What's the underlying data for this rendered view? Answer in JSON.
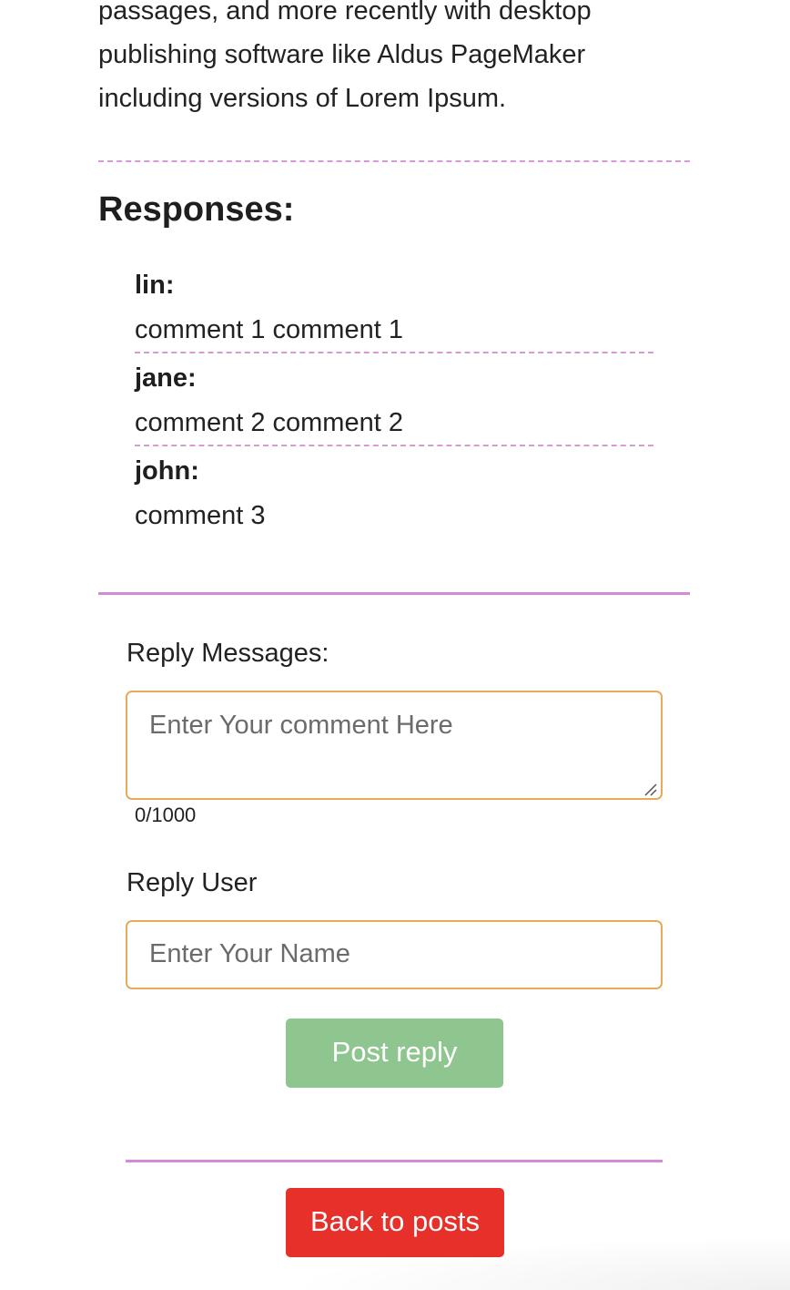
{
  "article": {
    "lines": [
      "passages, and more recently with desktop",
      "publishing software like Aldus PageMaker",
      "including versions of Lorem Ipsum."
    ]
  },
  "responses": {
    "heading": "Responses:",
    "items": [
      {
        "user": "lin:",
        "text": "comment 1 comment 1"
      },
      {
        "user": "jane:",
        "text": "comment 2 comment 2"
      },
      {
        "user": "john:",
        "text": "comment 3"
      }
    ]
  },
  "reply_form": {
    "message_label": "Reply Messages:",
    "message_placeholder": "Enter Your comment Here",
    "message_value": "",
    "char_counter": "0/1000",
    "user_label": "Reply User",
    "user_placeholder": "Enter Your Name",
    "user_value": "",
    "submit_label": "Post reply",
    "submit_color": "#8fc58f"
  },
  "navigation": {
    "back_label": "Back to posts",
    "back_color": "#e8302a"
  },
  "colors": {
    "separator": "#d48ad4",
    "input_border": "#e9a95a"
  }
}
